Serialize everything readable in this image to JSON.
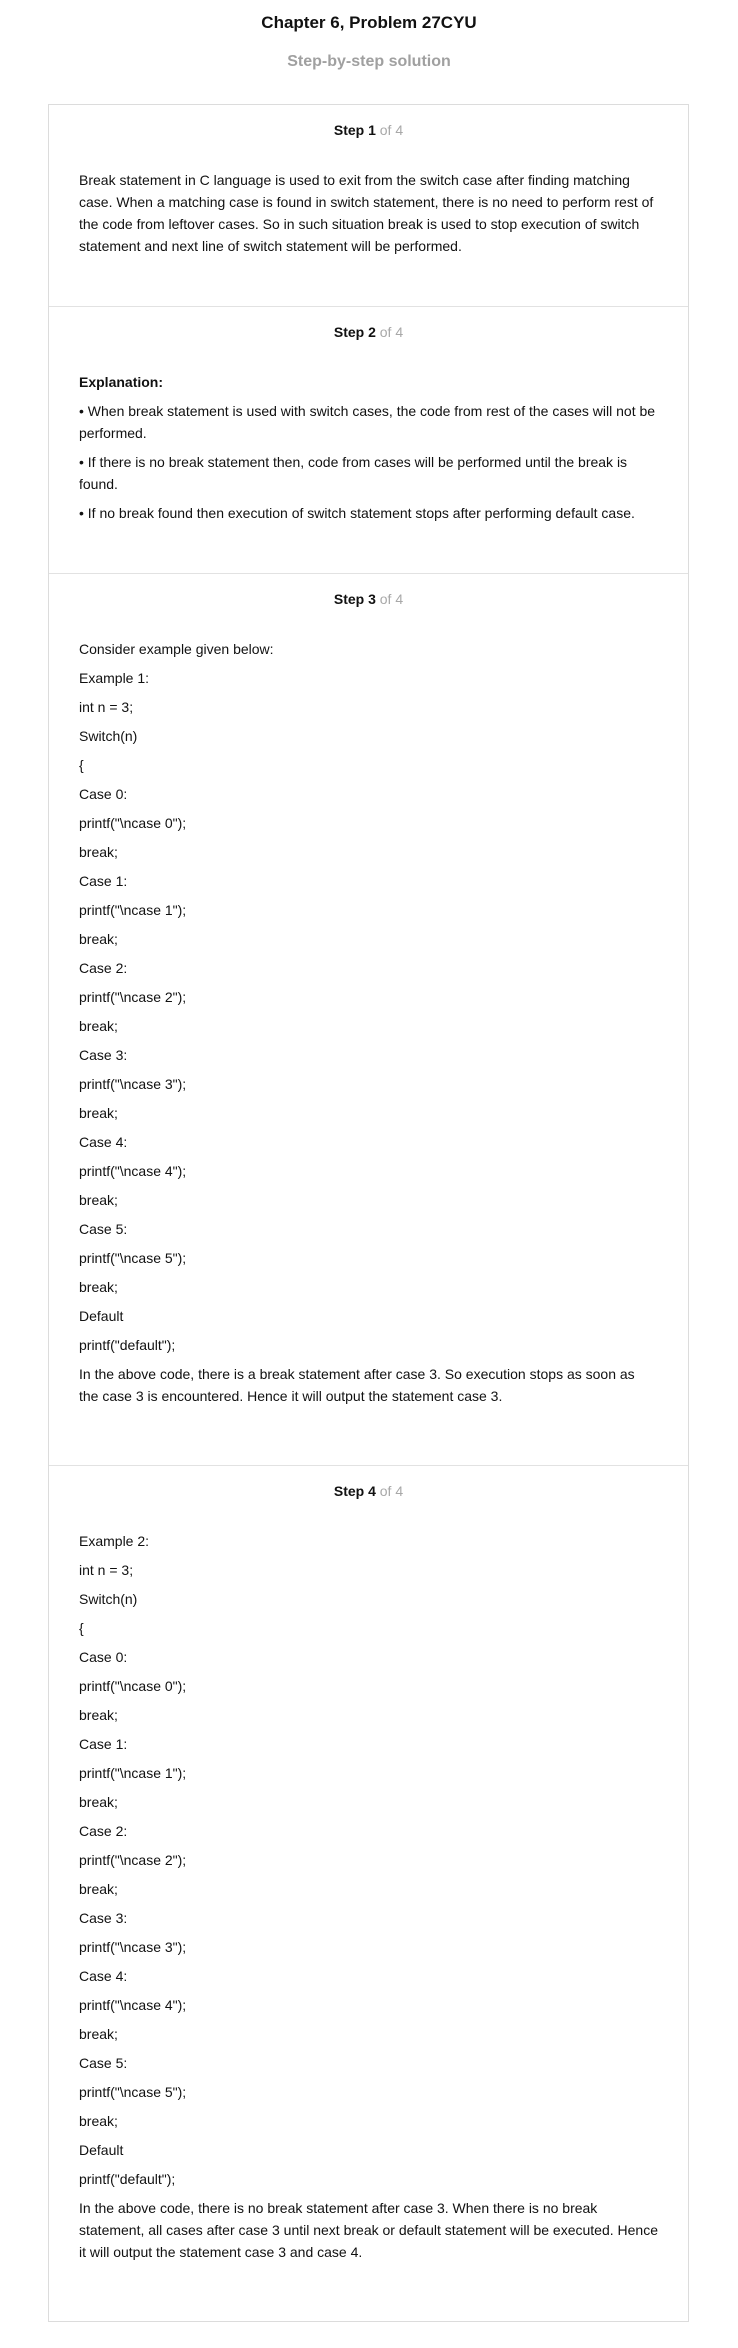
{
  "header": {
    "title": "Chapter 6, Problem 27CYU",
    "subtitle": "Step-by-step solution"
  },
  "steps": [
    {
      "label": "Step 1",
      "of": " of 4",
      "lines": [
        "Break statement in C language is used to exit from the switch case after finding matching case. When a matching case is found in switch statement, there is no need to perform rest of the code from leftover cases. So in such situation break is used to stop execution of switch statement and next line of switch statement will be performed."
      ]
    },
    {
      "label": "Step 2",
      "of": " of 4",
      "heading": "Explanation:",
      "lines": [
        "• When break statement is used with switch cases, the code from rest of the cases will not be performed.",
        "• If there is no break statement then, code from cases will be performed until the break is found.",
        "• If no break found then execution of switch statement stops after performing default case."
      ]
    },
    {
      "label": "Step 3",
      "of": " of 4",
      "lines": [
        "Consider example given below:",
        "Example 1:",
        "int n = 3;",
        "Switch(n)",
        "{",
        "Case 0:",
        "printf(\"\\ncase 0\");",
        "break;",
        "Case 1:",
        "printf(\"\\ncase 1\");",
        "break;",
        "Case 2:",
        "printf(\"\\ncase 2\");",
        "break;",
        "Case 3:",
        "printf(\"\\ncase 3\");",
        "break;",
        "Case 4:",
        "printf(\"\\ncase 4\");",
        "break;",
        "Case 5:",
        "printf(\"\\ncase 5\");",
        "break;",
        "Default",
        "printf(\"default\");",
        "In the above code, there is a break statement after case 3. So execution stops as soon as the case 3 is encountered. Hence it will output the statement case 3."
      ]
    },
    {
      "label": "Step 4",
      "of": " of 4",
      "lines": [
        "Example 2:",
        "int n = 3;",
        "Switch(n)",
        "{",
        "Case 0:",
        "printf(\"\\ncase 0\");",
        "break;",
        "Case 1:",
        "printf(\"\\ncase 1\");",
        "break;",
        "Case 2:",
        "printf(\"\\ncase 2\");",
        "break;",
        "Case 3:",
        "printf(\"\\ncase 3\");",
        "Case 4:",
        "printf(\"\\ncase 4\");",
        "break;",
        "Case 5:",
        "printf(\"\\ncase 5\");",
        "break;",
        "Default",
        "printf(\"default\");",
        "In the above code, there is no break statement after case 3. When there is no break statement, all cases after case 3 until next break or default statement will be executed. Hence it will output the statement case 3 and case 4."
      ]
    }
  ]
}
